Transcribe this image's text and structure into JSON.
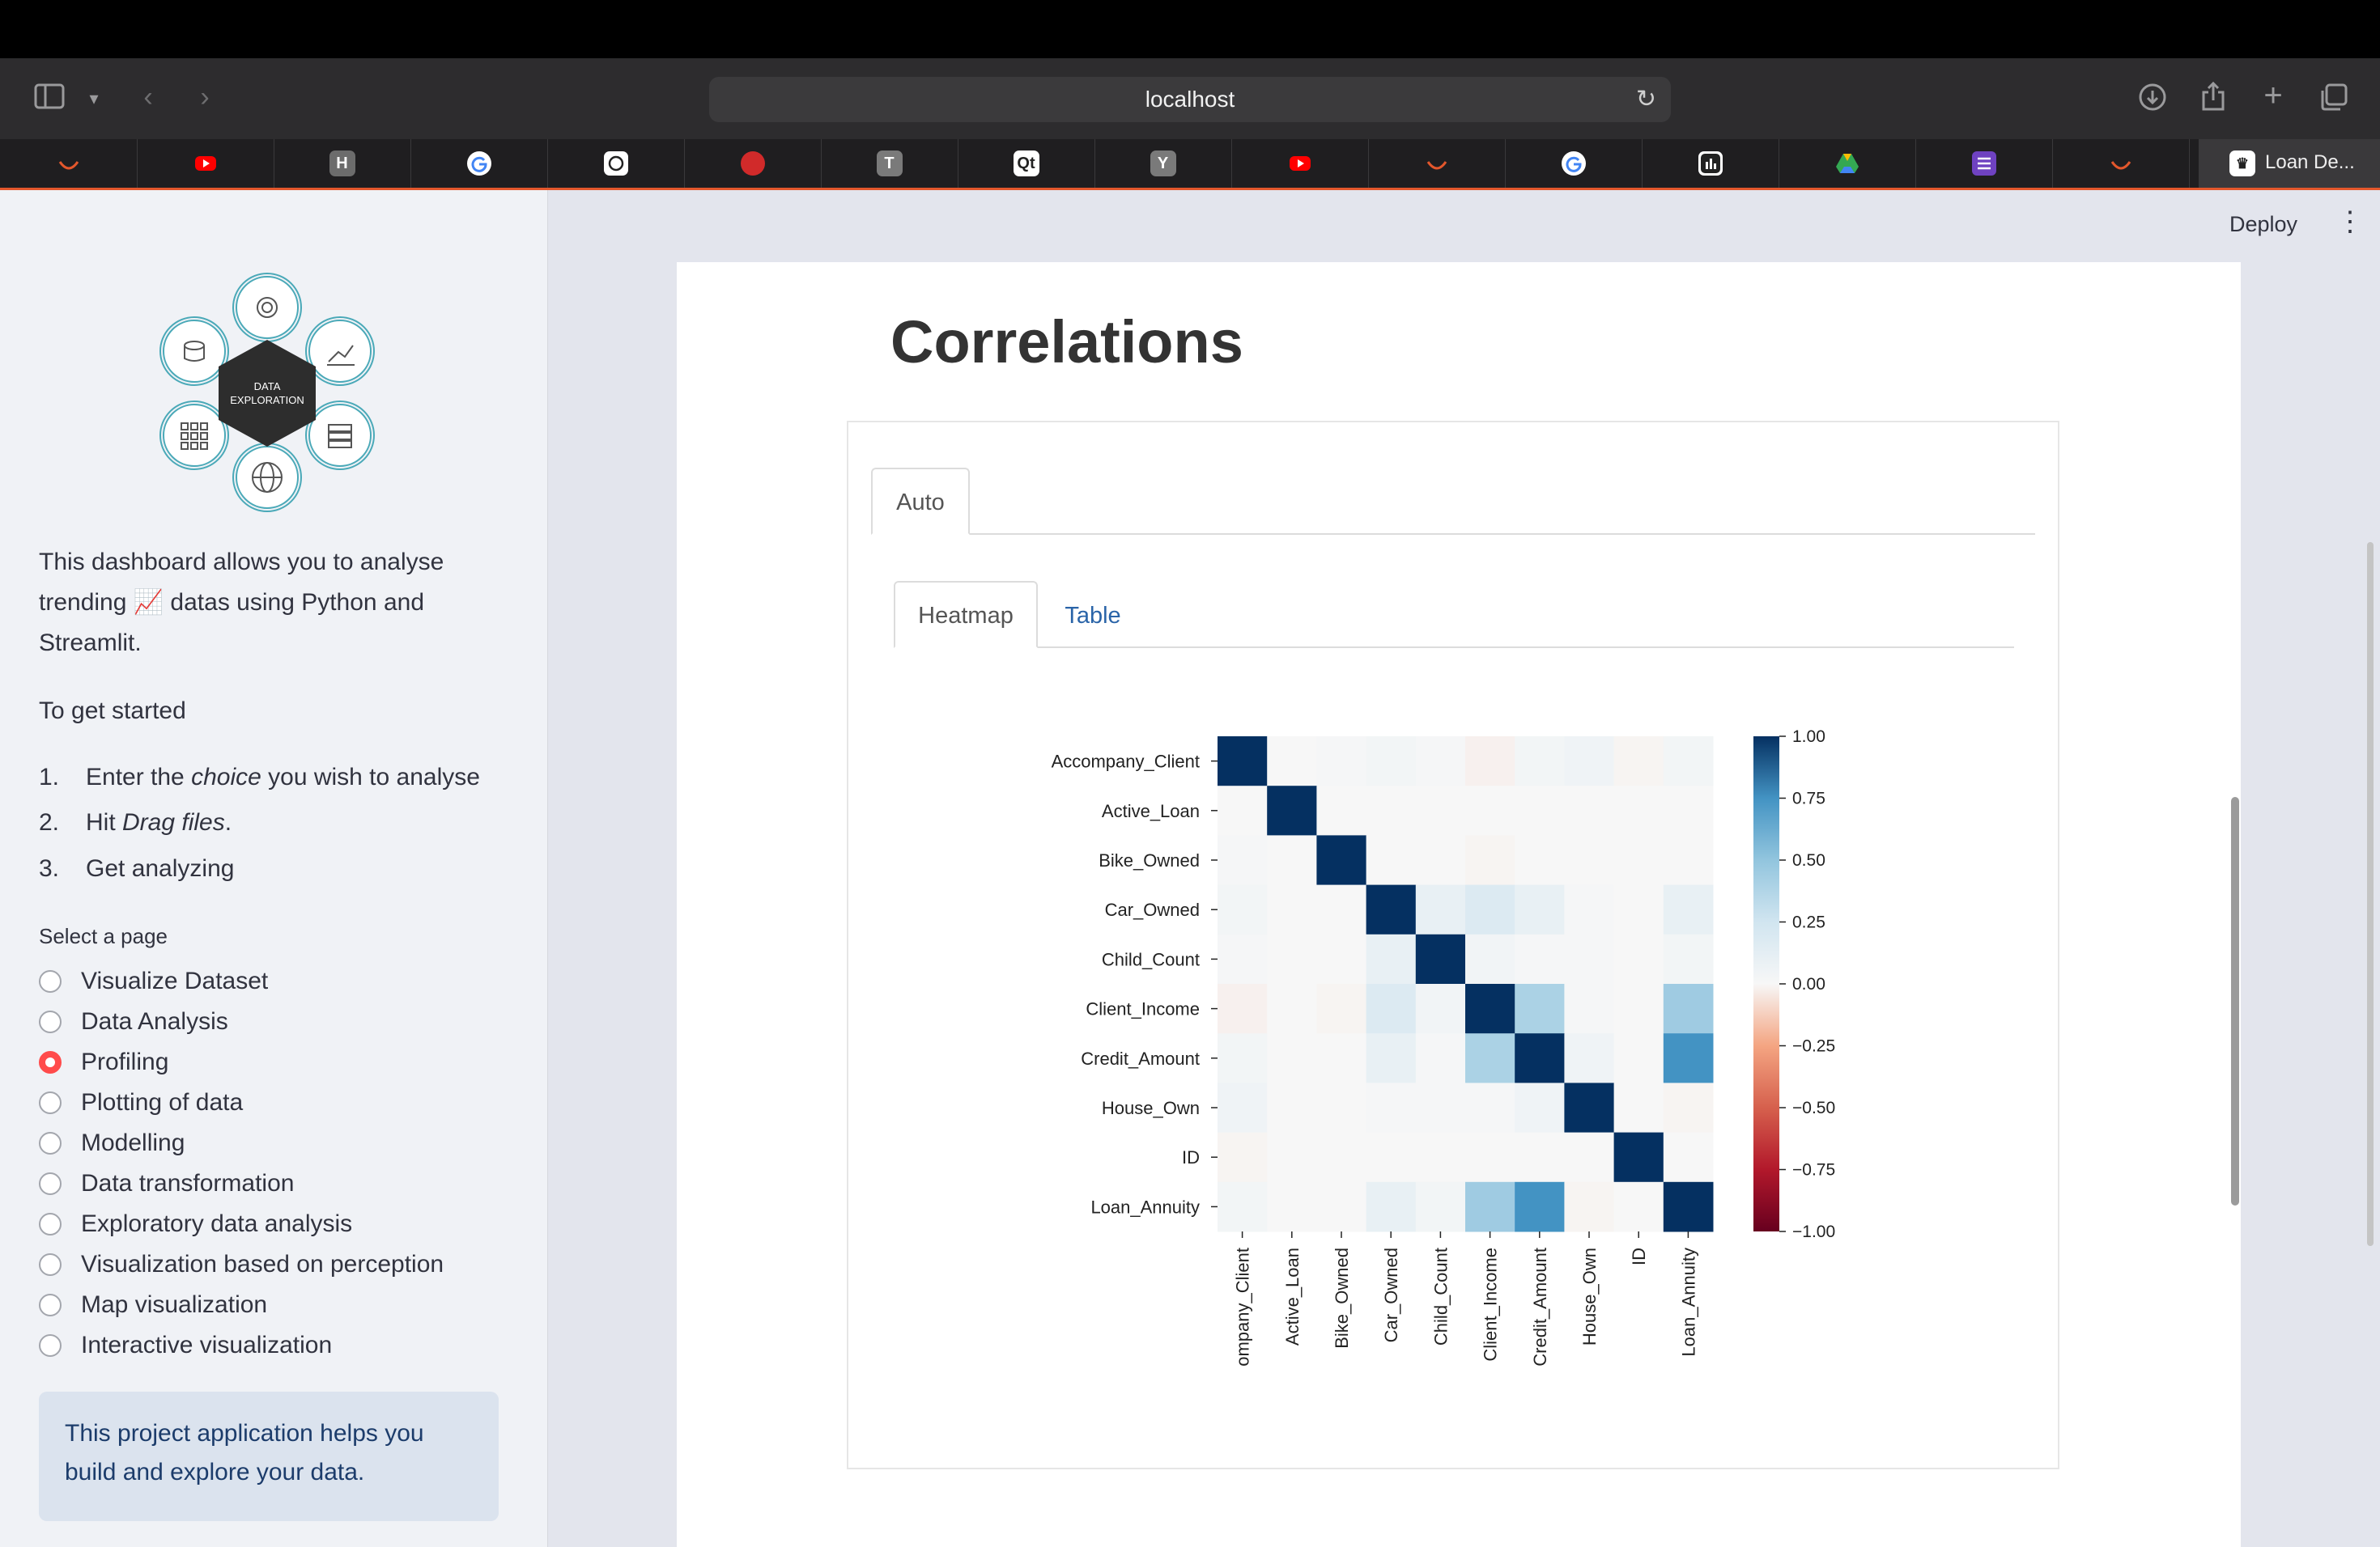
{
  "browser": {
    "url": "localhost",
    "active_tab_title": "Loan De...",
    "tabs": [
      {
        "icon": "orange-arc-icon",
        "color": "#e3572c"
      },
      {
        "icon": "youtube-icon",
        "color": "#ff0000"
      },
      {
        "icon": "h-letter-icon",
        "color": "#6c6c6c",
        "letter": "H"
      },
      {
        "icon": "google-icon",
        "color": "#ffffff",
        "letter": "G"
      },
      {
        "icon": "openai-icon",
        "color": "#ffffff"
      },
      {
        "icon": "red-circle-icon",
        "color": "#d12a2a"
      },
      {
        "icon": "t-letter-icon",
        "color": "#7a7a7a",
        "letter": "T"
      },
      {
        "icon": "qt-icon",
        "color": "#ffffff",
        "letter": "Qt"
      },
      {
        "icon": "y-letter-icon",
        "color": "#7a7a7a",
        "letter": "Y"
      },
      {
        "icon": "youtube-icon",
        "color": "#ff0000"
      },
      {
        "icon": "orange-arc-icon",
        "color": "#e3572c"
      },
      {
        "icon": "google-icon",
        "color": "#ffffff",
        "letter": "G"
      },
      {
        "icon": "bar-chart-app-icon",
        "color": "#ffffff"
      },
      {
        "icon": "google-drive-icon",
        "color": "#34a853"
      },
      {
        "icon": "purple-list-icon",
        "color": "#6f42c1"
      },
      {
        "icon": "orange-arc-icon",
        "color": "#e3572c"
      }
    ]
  },
  "sidebar": {
    "logo_text_1": "DATA",
    "logo_text_2": "EXPLORATION",
    "intro_1": "This dashboard allows you to analyse",
    "intro_2": "trending 📈 datas using Python and",
    "intro_3": "Streamlit.",
    "get_started": "To get started",
    "steps": [
      {
        "num": "1.",
        "pre": "Enter the ",
        "em": "choice",
        "post": " you wish to analyse"
      },
      {
        "num": "2.",
        "pre": "Hit ",
        "em": "Drag files",
        "post": "."
      },
      {
        "num": "3.",
        "pre": "Get analyzing",
        "em": "",
        "post": ""
      }
    ],
    "select_label": "Select a page",
    "pages": [
      "Visualize Dataset",
      "Data Analysis",
      "Profiling",
      "Plotting of data",
      "Modelling",
      "Data transformation",
      "Exploratory data analysis",
      "Visualization based on perception",
      "Map visualization",
      "Interactive visualization"
    ],
    "selected_page": "Profiling",
    "info_1": "This project application helps you",
    "info_2": "build and explore your data."
  },
  "header": {
    "deploy_label": "Deploy"
  },
  "main": {
    "title": "Correlations",
    "outer_tab": "Auto",
    "inner_tabs": [
      "Heatmap",
      "Table"
    ]
  },
  "chart_data": {
    "type": "heatmap",
    "variables": [
      "Accompany_Client",
      "Active_Loan",
      "Bike_Owned",
      "Car_Owned",
      "Child_Count",
      "Client_Income",
      "Credit_Amount",
      "House_Own",
      "ID",
      "Loan_Annuity"
    ],
    "x_tick_labels": [
      "ompany_Client",
      "Active_Loan",
      "Bike_Owned",
      "Car_Owned",
      "Child_Count",
      "Client_Income",
      "Credit_Amount",
      "House_Own",
      "ID",
      "Loan_Annuity"
    ],
    "matrix": [
      [
        1.0,
        0.0,
        0.01,
        0.03,
        0.01,
        -0.02,
        0.03,
        0.05,
        -0.01,
        0.03
      ],
      [
        0.0,
        1.0,
        0.0,
        0.0,
        0.0,
        0.0,
        0.0,
        0.0,
        0.0,
        0.0
      ],
      [
        0.01,
        0.0,
        1.0,
        0.0,
        0.0,
        -0.01,
        0.0,
        0.0,
        0.0,
        0.0
      ],
      [
        0.03,
        0.0,
        0.0,
        1.0,
        0.1,
        0.18,
        0.1,
        0.01,
        0.0,
        0.1
      ],
      [
        0.01,
        0.0,
        0.0,
        0.1,
        1.0,
        0.04,
        0.01,
        0.01,
        0.0,
        0.03
      ],
      [
        -0.02,
        0.0,
        -0.01,
        0.18,
        0.04,
        1.0,
        0.4,
        0.01,
        0.0,
        0.45
      ],
      [
        0.03,
        0.0,
        0.0,
        0.1,
        0.01,
        0.4,
        1.0,
        0.05,
        0.0,
        0.75
      ],
      [
        0.05,
        0.0,
        0.0,
        0.01,
        0.01,
        0.01,
        0.05,
        1.0,
        0.0,
        -0.01
      ],
      [
        -0.01,
        0.0,
        0.0,
        0.0,
        0.0,
        0.0,
        0.0,
        0.0,
        1.0,
        0.0
      ],
      [
        0.03,
        0.0,
        0.0,
        0.1,
        0.03,
        0.45,
        0.75,
        -0.01,
        0.0,
        1.0
      ]
    ],
    "colorbar_range": [
      -1.0,
      1.0
    ],
    "colorbar_ticks": [
      "1.00",
      "0.75",
      "0.50",
      "0.25",
      "0.00",
      "−0.25",
      "−0.50",
      "−0.75",
      "−1.00"
    ],
    "colormap": "RdBu"
  }
}
